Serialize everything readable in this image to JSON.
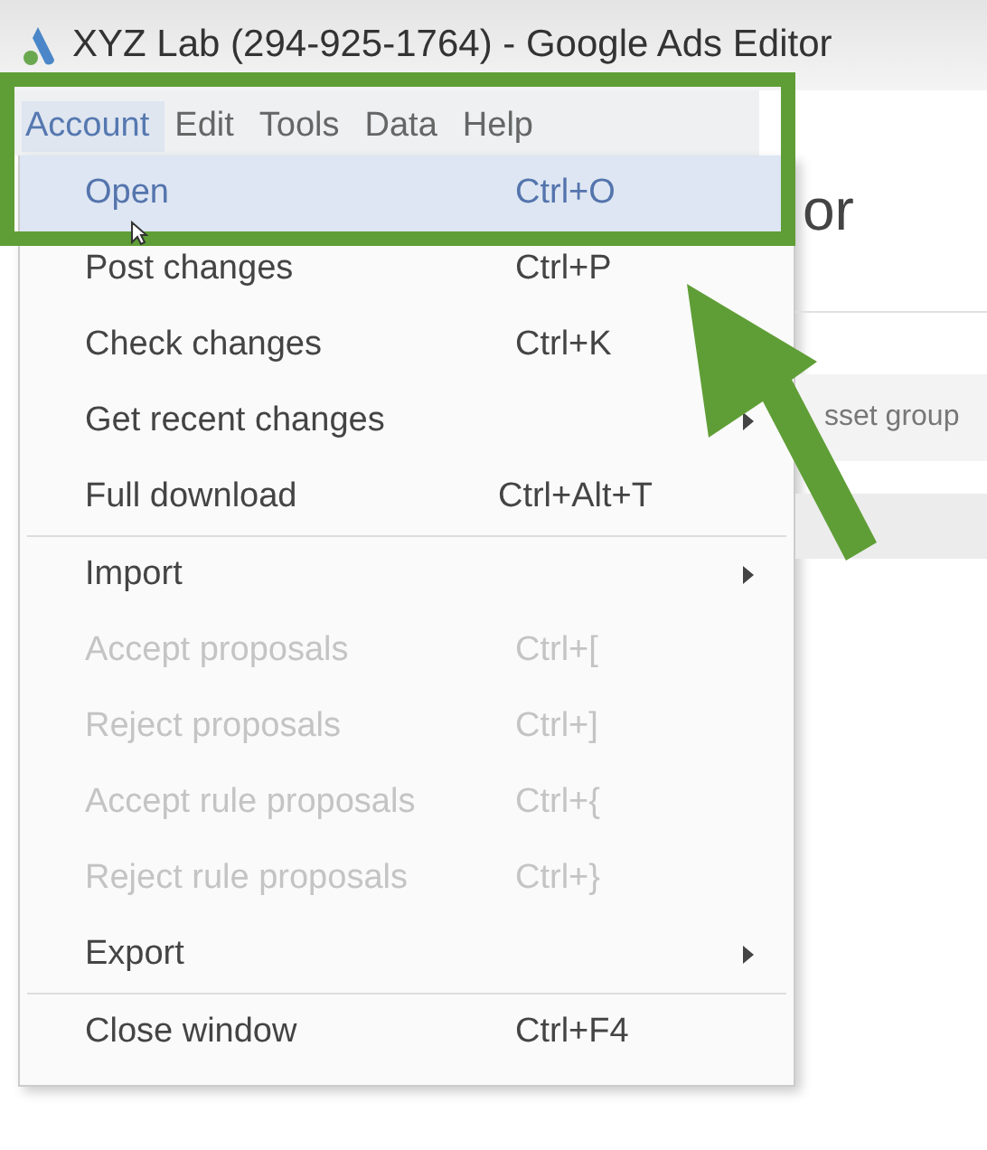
{
  "window": {
    "title": "XYZ Lab (294-925-1764) - Google Ads Editor"
  },
  "menubar": [
    {
      "label": "Account",
      "selected": true
    },
    {
      "label": "Edit",
      "selected": false
    },
    {
      "label": "Tools",
      "selected": false
    },
    {
      "label": "Data",
      "selected": false
    },
    {
      "label": "Help",
      "selected": false
    }
  ],
  "menu": [
    {
      "kind": "item",
      "label": "Open",
      "shortcut": "Ctrl+O",
      "selected": true,
      "disabled": false,
      "submenu": false
    },
    {
      "kind": "item",
      "label": "Post changes",
      "shortcut": "Ctrl+P",
      "selected": false,
      "disabled": false,
      "submenu": false
    },
    {
      "kind": "item",
      "label": "Check changes",
      "shortcut": "Ctrl+K",
      "selected": false,
      "disabled": false,
      "submenu": false
    },
    {
      "kind": "item",
      "label": "Get recent changes",
      "selected": false,
      "disabled": false,
      "submenu": true
    },
    {
      "kind": "item",
      "label": "Full download",
      "shortcut": "Ctrl+Alt+T",
      "selected": false,
      "disabled": false,
      "submenu": false
    },
    {
      "kind": "separator"
    },
    {
      "kind": "item",
      "label": "Import",
      "selected": false,
      "disabled": false,
      "submenu": true
    },
    {
      "kind": "item",
      "label": "Accept proposals",
      "shortcut": "Ctrl+[",
      "selected": false,
      "disabled": true,
      "submenu": false
    },
    {
      "kind": "item",
      "label": "Reject proposals",
      "shortcut": "Ctrl+]",
      "selected": false,
      "disabled": true,
      "submenu": false
    },
    {
      "kind": "item",
      "label": "Accept rule proposals",
      "shortcut": "Ctrl+{",
      "selected": false,
      "disabled": true,
      "submenu": false
    },
    {
      "kind": "item",
      "label": "Reject rule proposals",
      "shortcut": "Ctrl+}",
      "selected": false,
      "disabled": true,
      "submenu": false
    },
    {
      "kind": "item",
      "label": "Export",
      "selected": false,
      "disabled": false,
      "submenu": true
    },
    {
      "kind": "separator"
    },
    {
      "kind": "item",
      "label": "Close window",
      "shortcut": "Ctrl+F4",
      "selected": false,
      "disabled": false,
      "submenu": false
    }
  ],
  "background": {
    "heading": "or",
    "tab": "sset group"
  }
}
